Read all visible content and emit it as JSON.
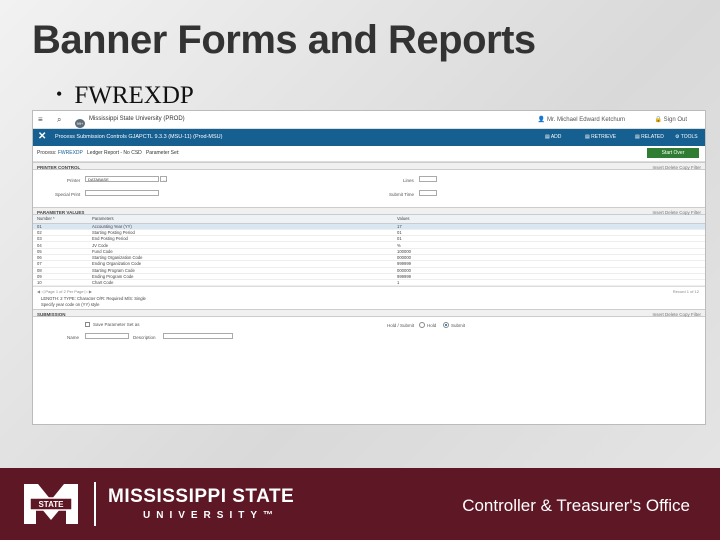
{
  "slide": {
    "title": "Banner Forms and Reports",
    "bullet": "FWREXDP"
  },
  "banner": {
    "topbar": {
      "institution": "Mississippi State University (PROD)",
      "user": "Mr. Michael Edward Ketchum",
      "signout": "Sign Out",
      "notification_count": "99+"
    },
    "form": {
      "title": "Process Submission Controls GJAPCTL 9.3.3 (MSU-11) (Prod-MSU)",
      "toolbar": {
        "add": "ADD",
        "retrieve": "RETRIEVE",
        "related": "RELATED",
        "tools": "TOOLS"
      }
    },
    "keyblock": {
      "crumb_process_label": "Process:",
      "process_value": "FWREXDP",
      "crumb_process_desc": "Ledger Report - No CSD",
      "crumb_paramset_label": "Parameter Set:",
      "start_over": "Start Over"
    },
    "printer_control": {
      "header": "PRINTER CONTROL",
      "actions": "Insert   Delete   Copy   Filter",
      "printer_label": "Printer",
      "printer_value": "DATABASE",
      "special_print_label": "Special Print",
      "lines_label": "Lines",
      "submit_time_label": "Submit Time"
    },
    "parameters": {
      "header": "PARAMETER VALUES",
      "actions": "Insert   Delete   Copy   Filter",
      "columns": [
        "Number *",
        "Parameters",
        "Values"
      ],
      "rows": [
        {
          "num": "01",
          "param": "Accounting Year (YY)",
          "value": "17"
        },
        {
          "num": "02",
          "param": "Starting Posting Period",
          "value": "01"
        },
        {
          "num": "03",
          "param": "End Posting Period",
          "value": "01"
        },
        {
          "num": "04",
          "param": "JV Code",
          "value": "%"
        },
        {
          "num": "05",
          "param": "Fund Code",
          "value": "100000"
        },
        {
          "num": "06",
          "param": "Starting Organization Code",
          "value": "000000"
        },
        {
          "num": "07",
          "param": "Ending Organization Code",
          "value": "999999"
        },
        {
          "num": "08",
          "param": "Starting Program Code",
          "value": "000000"
        },
        {
          "num": "09",
          "param": "Ending Program Code",
          "value": "999999"
        },
        {
          "num": "10",
          "param": "Chart Code",
          "value": "1"
        }
      ],
      "pager_left": "Page 1 of 2     Per Page",
      "pager_right": "Record 1 of 12",
      "hint_line1": "LENGTH: 2 TYPE: Character O/R: Required M/S: Single",
      "hint_line2": "Specify year code on (YY) style"
    },
    "submission": {
      "header": "SUBMISSION",
      "actions": "Insert   Delete   Copy   Filter",
      "save_label": "Save Parameter Set as",
      "name_label": "Name",
      "description_label": "Description",
      "hold_submit_label": "Hold / Submit",
      "hold": "Hold",
      "submit": "Submit"
    }
  },
  "footer": {
    "university_line1": "MISSISSIPPI STATE",
    "university_line2": "UNIVERSITY™",
    "logo_text": "STATE",
    "office": "Controller & Treasurer's Office"
  },
  "colors": {
    "maroon": "#5d1725",
    "banner_blue": "#155f91",
    "start_over_green": "#2e7d32"
  }
}
